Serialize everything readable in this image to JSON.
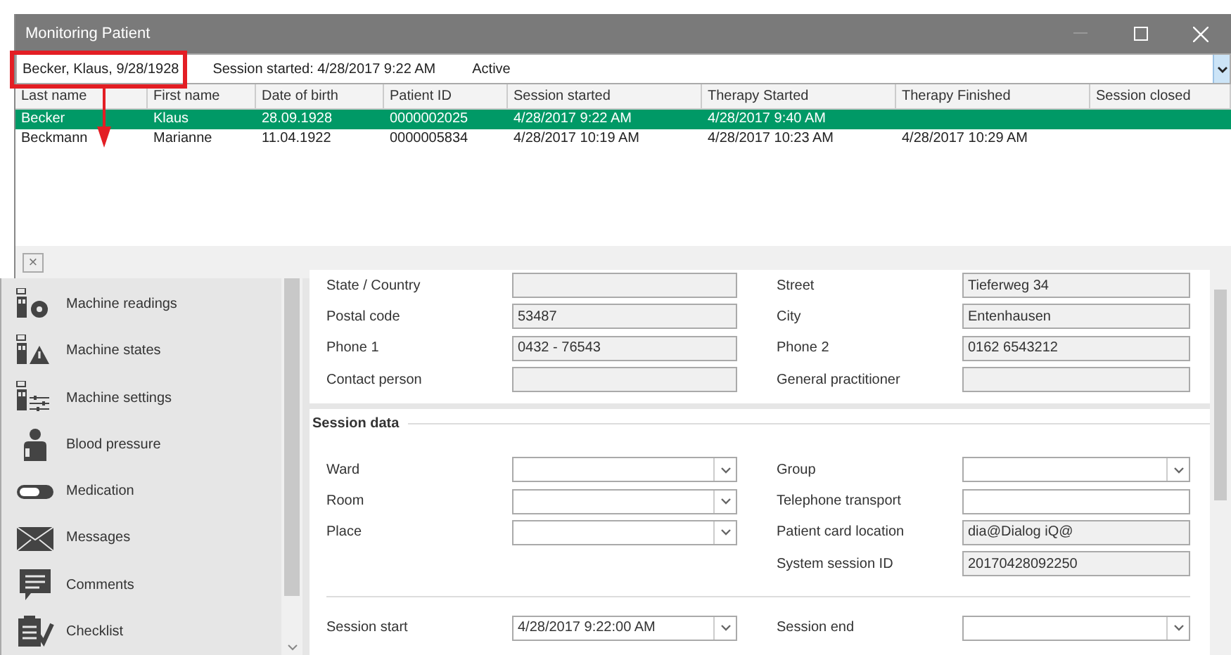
{
  "patient_popup": {
    "title": "Monitoring Patient",
    "selector": {
      "patient": "Becker, Klaus, 9/28/1928",
      "session": "Session started: 4/28/2017 9:22 AM",
      "status": "Active"
    },
    "columns": [
      "Last name",
      "First name",
      "Date of birth",
      "Patient ID",
      "Session started",
      "Therapy Started",
      "Therapy Finished",
      "Session closed"
    ],
    "rows": [
      {
        "selected": true,
        "cells": [
          "Becker",
          "Klaus",
          "28.09.1928",
          "0000002025",
          "4/28/2017 9:22 AM",
          "4/28/2017 9:40 AM",
          null,
          null
        ]
      },
      {
        "selected": false,
        "cells": [
          "Beckmann",
          "Marianne",
          "11.04.1922",
          "0000005834",
          "4/28/2017 10:19 AM",
          "4/28/2017 10:23 AM",
          "4/28/2017 10:29 AM",
          null
        ]
      }
    ],
    "close_button": "×"
  },
  "sidebar": {
    "items": [
      {
        "label": "Machine readings",
        "kind": "readings"
      },
      {
        "label": "Machine states",
        "kind": "states"
      },
      {
        "label": "Machine settings",
        "kind": "settings"
      },
      {
        "label": "Blood pressure",
        "kind": "pressure"
      },
      {
        "label": "Medication",
        "kind": "medication"
      },
      {
        "label": "Messages",
        "kind": "messages"
      },
      {
        "label": "Comments",
        "kind": "comments"
      },
      {
        "label": "Checklist",
        "kind": "checklist"
      }
    ]
  },
  "address_rows": [
    {
      "left": {
        "label": "State / Country",
        "kind": "readonly"
      },
      "right": {
        "label": "Street",
        "value": "Tieferweg 34",
        "kind": "readonly"
      }
    },
    {
      "left": {
        "label": "Postal code",
        "value": "53487",
        "kind": "readonly"
      },
      "right": {
        "label": "City",
        "value": "Entenhausen",
        "kind": "readonly"
      }
    },
    {
      "left": {
        "label": "Phone 1",
        "value": "0432 - 76543",
        "kind": "readonly"
      },
      "right": {
        "label": "Phone 2",
        "value": "0162 6543212",
        "kind": "readonly"
      }
    },
    {
      "left": {
        "label": "Contact person",
        "kind": "readonly"
      },
      "right": {
        "label": "General practitioner",
        "kind": "readonly"
      }
    }
  ],
  "session_data": {
    "title": "Session data",
    "rows": [
      {
        "left": {
          "label": "Ward",
          "kind": "select"
        },
        "right": {
          "label": "Group",
          "kind": "select"
        }
      },
      {
        "left": {
          "label": "Room",
          "kind": "select"
        },
        "right": {
          "label": "Telephone transport",
          "kind": "input"
        }
      },
      {
        "left": {
          "label": "Place",
          "kind": "select"
        },
        "right": {
          "label": "Patient card location",
          "value": "dia@Dialog iQ@",
          "kind": "readonly"
        }
      },
      {
        "right": {
          "label": "System session ID",
          "value": "20170428092250",
          "kind": "readonly"
        }
      }
    ],
    "time_rows": [
      {
        "left": {
          "label": "Session start",
          "value": "4/28/2017 9:22:00 AM",
          "kind": "select"
        },
        "right": {
          "label": "Session end",
          "kind": "select"
        }
      }
    ]
  }
}
